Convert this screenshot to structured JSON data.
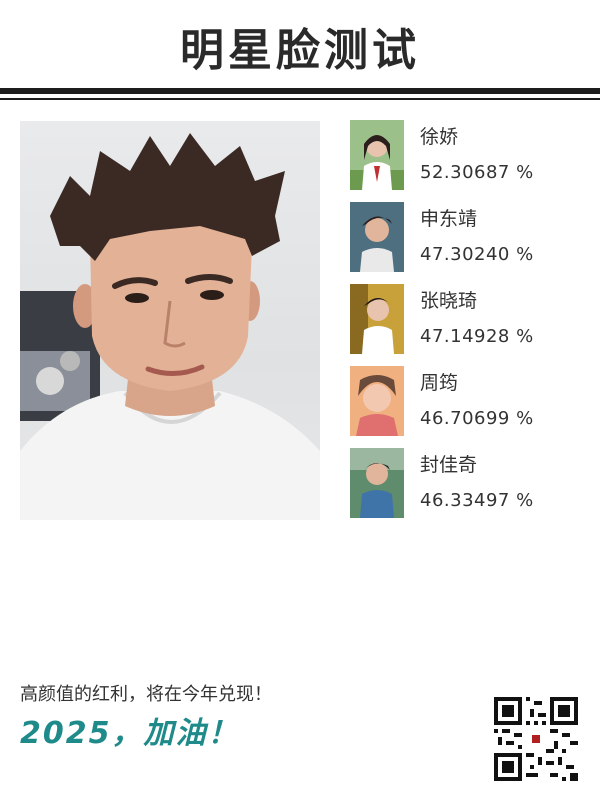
{
  "header": {
    "title": "明星脸测试"
  },
  "photo": {
    "subject": "uploaded-face-photo"
  },
  "results": [
    {
      "name": "徐娇",
      "score": "52.30687 %",
      "thumb_color": "#7da56a"
    },
    {
      "name": "申东靖",
      "score": "47.30240 %",
      "thumb_color": "#5f7f8f"
    },
    {
      "name": "张晓琦",
      "score": "47.14928 %",
      "thumb_color": "#c9a13a"
    },
    {
      "name": "周筠",
      "score": "46.70699 %",
      "thumb_color": "#e39a6a"
    },
    {
      "name": "封佳奇",
      "score": "46.33497 %",
      "thumb_color": "#4f7a5e"
    }
  ],
  "footer": {
    "slogan": "高颜值的红利，将在今年兑现！",
    "cheer": "2025，加油！",
    "qr_icon": "qr-code-icon"
  },
  "colors": {
    "accent": "#1e8a8a",
    "title": "#2a2a2a"
  }
}
